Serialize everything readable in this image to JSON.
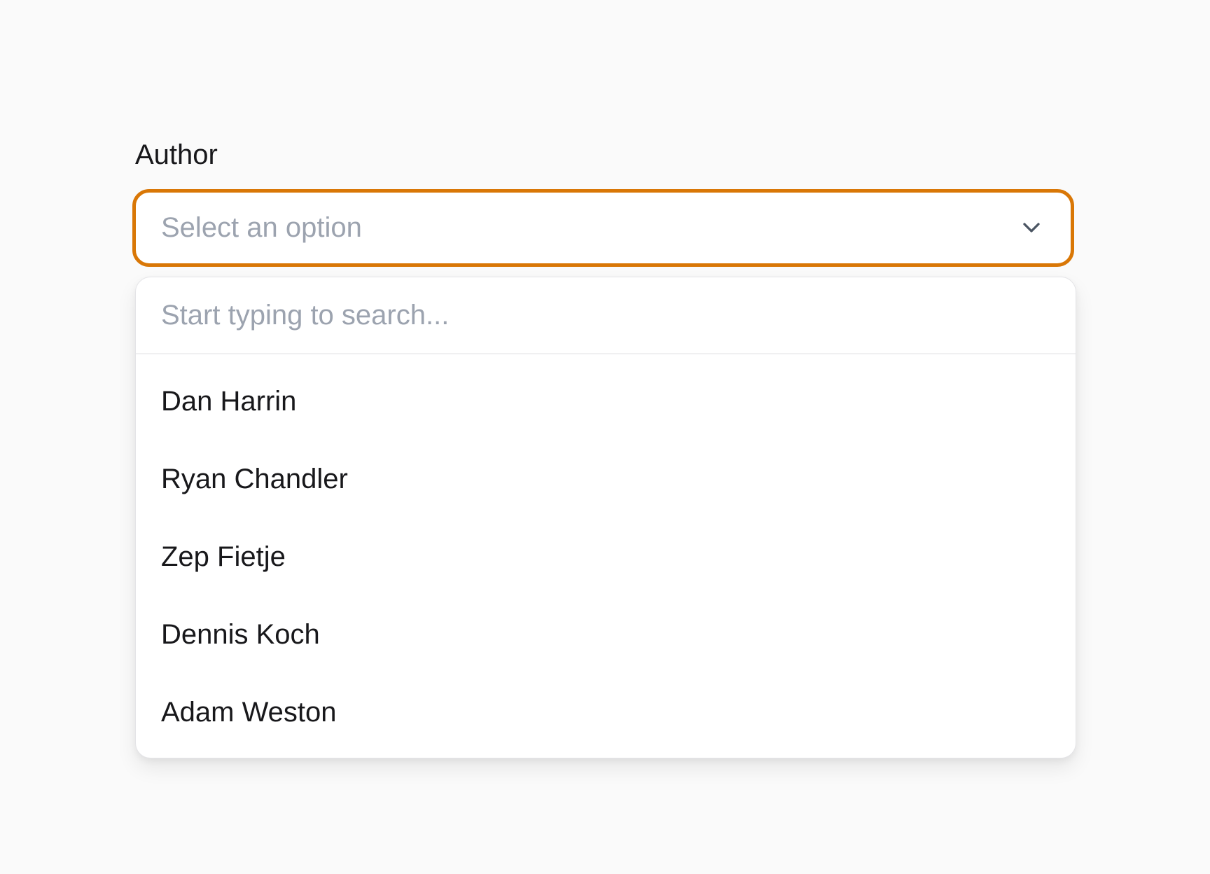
{
  "field": {
    "label": "Author",
    "placeholder": "Select an option",
    "chevron_icon": "chevron-down-icon"
  },
  "dropdown": {
    "search_placeholder": "Start typing to search...",
    "options": [
      {
        "label": "Dan Harrin"
      },
      {
        "label": "Ryan Chandler"
      },
      {
        "label": "Zep Fietje"
      },
      {
        "label": "Dennis Koch"
      },
      {
        "label": "Adam Weston"
      }
    ]
  },
  "colors": {
    "accent": "#d97706",
    "background": "#fafafa",
    "placeholder_text": "#9ca3af",
    "text": "#18181b"
  }
}
